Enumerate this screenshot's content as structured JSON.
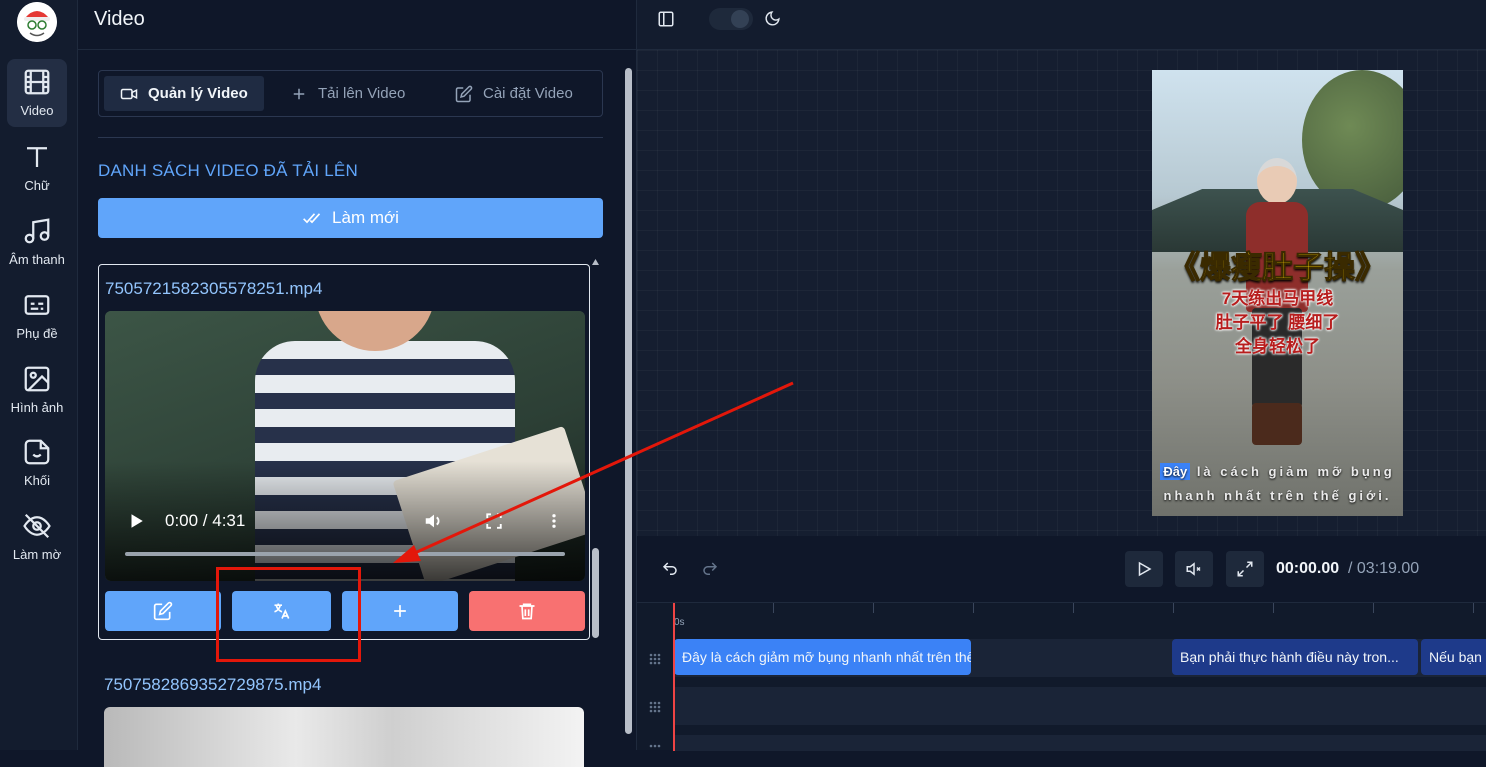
{
  "sidebar": {
    "items": [
      {
        "label": "Video",
        "icon": "film-icon"
      },
      {
        "label": "Chữ",
        "icon": "text-icon"
      },
      {
        "label": "Âm thanh",
        "icon": "music-icon"
      },
      {
        "label": "Phụ đề",
        "icon": "subtitles-icon"
      },
      {
        "label": "Hình ảnh",
        "icon": "image-icon"
      },
      {
        "label": "Khối",
        "icon": "sticker-icon"
      },
      {
        "label": "Làm mờ",
        "icon": "eye-off-icon"
      }
    ],
    "active": "Video"
  },
  "panel": {
    "title": "Video",
    "tabs": [
      {
        "label": "Quản lý Video",
        "icon": "video-camera-icon"
      },
      {
        "label": "Tải lên Video",
        "icon": "plus-icon"
      },
      {
        "label": "Cài đặt Video",
        "icon": "edit-icon"
      }
    ],
    "active_tab": "Quản lý Video",
    "section_title": "DANH SÁCH VIDEO ĐÃ TẢI LÊN",
    "refresh_label": "Làm mới",
    "videos": [
      {
        "name": "7505721582305578251.mp4",
        "time": "0:00 / 4:31"
      },
      {
        "name": "7507582869352729875.mp4"
      }
    ]
  },
  "preview": {
    "title": "《爆瘦肚子操》",
    "lines": [
      "7天练出马甲线",
      "肚子平了 腰细了",
      "全身轻松了"
    ],
    "subtitle_highlight": "Đây",
    "subtitle_rest": " là cách giảm mỡ bụng",
    "subtitle_line2": "nhanh nhất trên thế giới."
  },
  "player": {
    "current_time": "00:00.00",
    "total_time": "/ 03:19.00"
  },
  "timeline": {
    "ruler_start": "0s",
    "clips": [
      "Đây là cách giảm mỡ bụng nhanh nhất trên thế giới.",
      "Bạn phải thực hành điều này tron...",
      "Nếu bạn"
    ]
  },
  "colors": {
    "accent": "#60a5fa",
    "danger": "#f87171",
    "clip_active": "#3b82f6",
    "clip": "#1e3a8a",
    "annotation": "#e3170a"
  }
}
